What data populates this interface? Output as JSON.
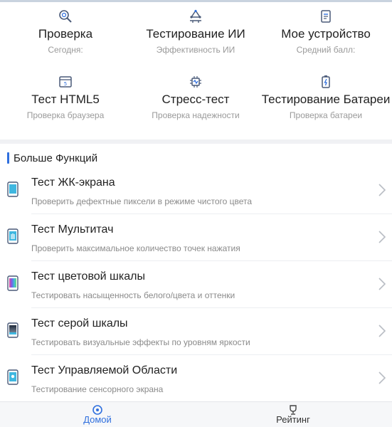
{
  "grid": [
    {
      "title": "Проверка",
      "subtitle": "Сегодня:",
      "icon": "magnifier-icon"
    },
    {
      "title": "Тестирование ИИ",
      "subtitle": "Эффективность ИИ",
      "icon": "ai-network-icon"
    },
    {
      "title": "Мое устройство",
      "subtitle": "Средний балл:",
      "icon": "document-device-icon"
    },
    {
      "title": "Тест HTML5",
      "subtitle": "Проверка браузера",
      "icon": "html5-browser-icon"
    },
    {
      "title": "Стресс-тест",
      "subtitle": "Проверка надежности",
      "icon": "chip-stress-icon"
    },
    {
      "title": "Тестирование Батареи",
      "subtitle": "Проверка батареи",
      "icon": "battery-icon"
    }
  ],
  "section": {
    "title": "Больше Функций"
  },
  "list": [
    {
      "title": "Тест ЖК-экрана",
      "subtitle": "Проверить дефектные пиксели в режиме чистого цвета",
      "icon": "lcd-screen-icon"
    },
    {
      "title": "Тест Мультитач",
      "subtitle": "Проверить максимальное количество точек нажатия",
      "icon": "multitouch-icon"
    },
    {
      "title": "Тест цветовой шкалы",
      "subtitle": "Тестировать насыщенность белого/цвета и оттенки",
      "icon": "color-scale-icon"
    },
    {
      "title": "Тест серой шкалы",
      "subtitle": "Тестировать визуальные эффекты по уровням яркости",
      "icon": "gray-scale-icon"
    },
    {
      "title": "Тест Управляемой Области",
      "subtitle": "Тестирование сенсорного экрана",
      "icon": "touch-area-icon"
    }
  ],
  "tabs": [
    {
      "label": "Домой",
      "icon": "home-icon",
      "active": true
    },
    {
      "label": "Рейтинг",
      "icon": "trophy-icon",
      "active": false
    }
  ],
  "colors": {
    "accent": "#2f6fde",
    "subtext": "#9a9a9a",
    "divider": "#f0f1f4"
  }
}
